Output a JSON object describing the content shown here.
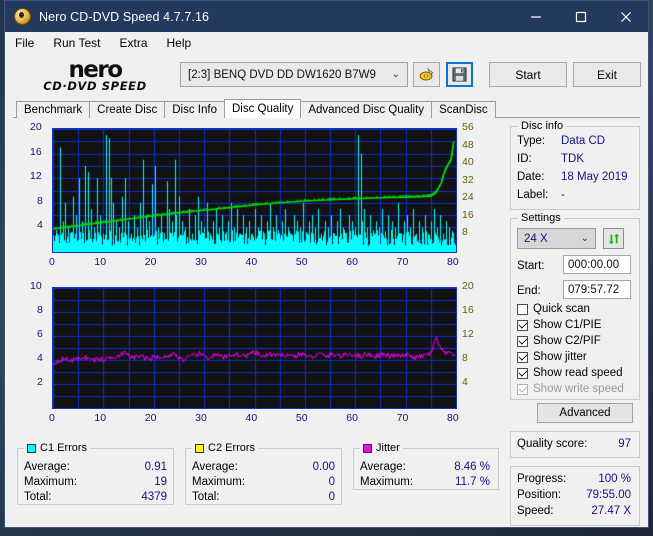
{
  "window": {
    "title": "Nero CD-DVD Speed 4.7.7.16",
    "minimize": "–",
    "maximize": "□",
    "close": "✕"
  },
  "menu": [
    "File",
    "Run Test",
    "Extra",
    "Help"
  ],
  "logo": {
    "line1": "nero",
    "line2": "CD·DVD SPEED"
  },
  "toolbar": {
    "drive": "[2:3]   BENQ DVD DD DW1620 B7W9",
    "chevron": "⌄",
    "disc_icon": "disc-eject-icon",
    "save_icon": "floppy-save-icon",
    "start_label": "Start",
    "exit_label": "Exit"
  },
  "tabs": [
    {
      "label": "Benchmark",
      "active": false
    },
    {
      "label": "Create Disc",
      "active": false
    },
    {
      "label": "Disc Info",
      "active": false
    },
    {
      "label": "Disc Quality",
      "active": true
    },
    {
      "label": "Advanced Disc Quality",
      "active": false
    },
    {
      "label": "ScanDisc",
      "active": false
    }
  ],
  "disc_info": {
    "title": "Disc info",
    "type_label": "Type:",
    "type_value": "Data CD",
    "id_label": "ID:",
    "id_value": "TDK",
    "date_label": "Date:",
    "date_value": "18 May 2019",
    "label_label": "Label:",
    "label_value": "-"
  },
  "settings": {
    "title": "Settings",
    "speed": "24 X",
    "chevron": "⌄",
    "refresh_icon": "refresh-speed-icon",
    "start_label": "Start:",
    "start_value": "000:00.00",
    "end_label": "End:",
    "end_value": "079:57.72",
    "checkboxes": [
      {
        "label": "Quick scan",
        "checked": false,
        "disabled": false
      },
      {
        "label": "Show C1/PIE",
        "checked": true,
        "disabled": false
      },
      {
        "label": "Show C2/PIF",
        "checked": true,
        "disabled": false
      },
      {
        "label": "Show jitter",
        "checked": true,
        "disabled": false
      },
      {
        "label": "Show read speed",
        "checked": true,
        "disabled": false
      },
      {
        "label": "Show write speed",
        "checked": true,
        "disabled": true
      }
    ],
    "advanced_label": "Advanced"
  },
  "quality": {
    "label": "Quality score:",
    "value": "97"
  },
  "status": {
    "progress_label": "Progress:",
    "progress_value": "100 %",
    "position_label": "Position:",
    "position_value": "79:55.00",
    "speed_label": "Speed:",
    "speed_value": "27.47 X"
  },
  "stats": {
    "c1": {
      "title": "C1 Errors",
      "color": "#00ffff",
      "rows": [
        {
          "k": "Average:",
          "v": "0.91"
        },
        {
          "k": "Maximum:",
          "v": "19"
        },
        {
          "k": "Total:",
          "v": "4379"
        }
      ]
    },
    "c2": {
      "title": "C2 Errors",
      "color": "#ffff00",
      "rows": [
        {
          "k": "Average:",
          "v": "0.00"
        },
        {
          "k": "Maximum:",
          "v": "0"
        },
        {
          "k": "Total:",
          "v": "0"
        }
      ]
    },
    "jitter": {
      "title": "Jitter",
      "color": "#ff00ff",
      "rows": [
        {
          "k": "Average:",
          "v": "8.46 %"
        },
        {
          "k": "Maximum:",
          "v": "11.7 %"
        }
      ]
    }
  },
  "chart_data": [
    {
      "type": "line",
      "name": "c1-error-chart",
      "title": "",
      "xlabel": "",
      "ylabel": "C1 errors",
      "xlim": [
        0,
        80
      ],
      "ylim": [
        0,
        20
      ],
      "xticks": [
        0,
        10,
        20,
        30,
        40,
        50,
        60,
        70,
        80
      ],
      "yticks_left": [
        4,
        8,
        12,
        16,
        20
      ],
      "yticks_right": [
        8,
        16,
        24,
        32,
        40,
        48,
        56
      ],
      "right_ylim": [
        0,
        56
      ],
      "right_ylabel": "read speed (X)",
      "grid": true,
      "bg": "#121212",
      "grid_color": "#1030c8",
      "series": [
        {
          "name": "C1 errors",
          "color": "#00ffff",
          "render": "spikes",
          "x": [
            0.3,
            0.8,
            1.4,
            2.0,
            2.4,
            2.9,
            3.4,
            4.0,
            4.6,
            5.2,
            5.8,
            6.4,
            7.0,
            7.6,
            8.2,
            8.8,
            9.4,
            10.0,
            10.6,
            11.2,
            11.5,
            11.9,
            12.5,
            13.1,
            13.7,
            14.3,
            14.9,
            15.5,
            16.1,
            16.7,
            17.3,
            17.9,
            18.5,
            19.1,
            19.7,
            20.3,
            20.9,
            21.5,
            22.1,
            22.7,
            23.0,
            23.6,
            24.2,
            24.5,
            25.1,
            25.7,
            26.3,
            26.9,
            27.5,
            28.1,
            28.7,
            29.3,
            29.9,
            30.5,
            31.1,
            31.7,
            32.3,
            32.9,
            33.5,
            34.1,
            34.7,
            35.3,
            35.9,
            36.5,
            37.1,
            37.7,
            38.3,
            38.9,
            39.5,
            40.1,
            40.7,
            41.3,
            41.9,
            42.5,
            43.1,
            43.7,
            44.3,
            44.9,
            45.5,
            46.1,
            46.7,
            47.3,
            47.9,
            48.5,
            49.1,
            49.7,
            50.3,
            50.9,
            51.5,
            52.1,
            52.7,
            53.3,
            53.9,
            54.5,
            55.1,
            55.7,
            56.3,
            56.9,
            57.5,
            58.1,
            58.7,
            59.3,
            59.9,
            60.5,
            61.1,
            61.4,
            61.8,
            62.4,
            63.0,
            63.6,
            64.2,
            64.8,
            65.4,
            66.0,
            66.6,
            67.2,
            67.8,
            68.4,
            69.0,
            69.6,
            70.2,
            70.8,
            71.4,
            72.0,
            72.6,
            73.2,
            73.8,
            74.4,
            75.0,
            75.6,
            76.2,
            76.8,
            77.4,
            78.0,
            78.6,
            79.2,
            79.6
          ],
          "y": [
            2,
            3,
            17,
            5,
            8,
            4,
            3,
            9,
            6,
            12,
            5,
            14,
            13,
            7,
            4,
            12,
            6,
            3,
            19,
            18.5,
            12,
            8,
            5,
            4,
            9,
            12,
            5,
            3,
            6,
            4,
            8,
            15,
            6,
            5,
            11,
            14,
            4,
            6,
            3,
            11.5,
            7,
            5,
            15,
            6,
            9,
            5,
            4,
            7,
            3,
            6,
            9,
            5,
            4,
            8,
            3,
            5,
            7,
            4,
            6,
            3,
            5,
            8,
            4,
            7,
            3,
            6,
            4,
            5,
            3,
            7,
            4,
            6,
            3,
            5,
            8,
            4,
            6,
            3,
            5,
            7,
            4,
            3,
            6,
            5,
            4,
            8,
            3,
            5,
            6,
            4,
            7,
            3,
            5,
            4,
            6,
            3,
            5,
            7,
            4,
            3,
            6,
            5,
            4,
            19,
            16,
            5,
            7,
            4,
            6,
            3,
            5,
            4,
            7,
            3,
            6,
            5,
            4,
            8,
            3,
            5,
            6,
            4,
            7,
            3,
            5,
            4,
            6,
            3,
            5,
            7,
            4,
            6,
            3,
            5,
            4
          ]
        },
        {
          "name": "Read speed",
          "color": "#00e000",
          "render": "line",
          "x": [
            0,
            5,
            10,
            15,
            20,
            25,
            30,
            35,
            40,
            45,
            50,
            55,
            60,
            65,
            70,
            73,
            75,
            76,
            77,
            77.5,
            78,
            78.5,
            79,
            79.5
          ],
          "y_right": [
            10.5,
            12,
            13.5,
            15,
            16.5,
            17.8,
            19,
            20.2,
            21.4,
            22.4,
            23.2,
            23.8,
            24.3,
            24.7,
            25,
            25.2,
            25.4,
            27,
            31,
            35,
            38,
            40,
            42,
            50
          ]
        }
      ]
    },
    {
      "type": "line",
      "name": "jitter-chart",
      "title": "",
      "xlabel": "",
      "ylabel": "jitter",
      "xlim": [
        0,
        80
      ],
      "ylim": [
        0,
        10
      ],
      "xticks": [
        0,
        10,
        20,
        30,
        40,
        50,
        60,
        70,
        80
      ],
      "yticks_left": [
        2,
        4,
        6,
        8,
        10
      ],
      "yticks_right": [
        4,
        8,
        12,
        16,
        20
      ],
      "right_ylim": [
        0,
        20
      ],
      "grid": true,
      "bg": "#121212",
      "grid_color": "#1030c8",
      "series": [
        {
          "name": "Jitter",
          "color": "#ff00ff",
          "render": "line",
          "x": [
            0,
            1,
            2,
            3,
            4,
            5,
            6,
            7,
            8,
            9,
            10,
            11,
            12,
            13,
            14,
            15,
            16,
            17,
            18,
            19,
            20,
            21,
            22,
            23,
            24,
            25,
            26,
            27,
            28,
            29,
            30,
            31,
            32,
            33,
            34,
            35,
            36,
            37,
            38,
            39,
            40,
            41,
            42,
            43,
            44,
            45,
            46,
            47,
            48,
            49,
            50,
            51,
            52,
            53,
            54,
            55,
            56,
            57,
            58,
            59,
            60,
            61,
            62,
            63,
            64,
            65,
            66,
            67,
            68,
            69,
            70,
            71,
            72,
            73,
            74,
            75,
            76,
            77,
            78,
            79,
            79.5
          ],
          "y": [
            3.7,
            4.0,
            4.1,
            4.0,
            4.0,
            4.1,
            4.3,
            4.1,
            4.0,
            4.1,
            4.0,
            4.2,
            4.3,
            4.4,
            4.6,
            4.3,
            4.2,
            4.3,
            4.2,
            4.1,
            4.2,
            4.3,
            4.2,
            4.4,
            4.5,
            4.2,
            4.0,
            4.2,
            4.4,
            4.5,
            4.3,
            4.2,
            4.4,
            4.3,
            4.2,
            4.4,
            4.5,
            4.4,
            4.3,
            4.5,
            4.6,
            4.4,
            4.3,
            4.5,
            4.4,
            4.3,
            4.5,
            4.4,
            4.3,
            4.5,
            4.4,
            4.2,
            4.4,
            4.5,
            4.3,
            4.4,
            4.5,
            4.3,
            4.4,
            4.5,
            4.4,
            4.3,
            4.5,
            4.4,
            4.3,
            4.5,
            4.4,
            4.3,
            4.4,
            4.3,
            4.4,
            4.3,
            4.2,
            4.3,
            4.4,
            4.6,
            5.8,
            4.8,
            4.5,
            4.6,
            4.5
          ]
        }
      ]
    }
  ]
}
